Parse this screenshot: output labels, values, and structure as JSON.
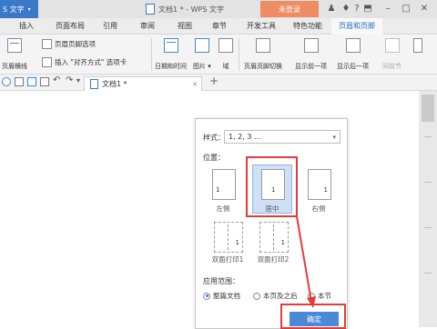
{
  "window": {
    "app_menu": "S 文字",
    "title": "文档1 * - WPS 文字",
    "login_button": "未登录"
  },
  "menu_tabs": [
    {
      "label": "插入"
    },
    {
      "label": "页面布局"
    },
    {
      "label": "引用"
    },
    {
      "label": "审阅"
    },
    {
      "label": "视图"
    },
    {
      "label": "章节"
    },
    {
      "label": "开发工具"
    },
    {
      "label": "特色功能"
    },
    {
      "label": "页眉和页脚",
      "active": true
    }
  ],
  "ribbon": {
    "header_line": "页眉横线",
    "header_footer_options": "页眉页脚选项",
    "insert_align_tab": "插入 \"对齐方式\" 选项卡",
    "date_time": "日期和时间",
    "picture": "图片",
    "field": "域",
    "hf_switch": "页眉页脚切换",
    "show_prev": "显示前一项",
    "show_next": "显示后一项",
    "same_as_prev": "同前节"
  },
  "doc_tab": {
    "label": "文档1 *"
  },
  "dialog": {
    "style_label": "样式：",
    "style_value": "1, 2, 3 ...",
    "position_label": "位置：",
    "positions": [
      {
        "label": "左侧",
        "number": "1"
      },
      {
        "label": "居中",
        "number": "1",
        "selected": true
      },
      {
        "label": "右侧",
        "number": "1"
      },
      {
        "label": "双面打印1",
        "number": "1"
      },
      {
        "label": "双面打印2",
        "number": "1"
      }
    ],
    "scope_label": "应用范围：",
    "scopes": [
      {
        "label": "整篇文档",
        "selected": true
      },
      {
        "label": "本页及之后",
        "selected": false
      },
      {
        "label": "本节",
        "selected": false
      }
    ],
    "ok_button": "确定"
  },
  "colors": {
    "accent_blue": "#2e73c4",
    "login_orange": "#f08c64",
    "highlight_red": "#e53a3a",
    "ok_blue": "#4a88d8"
  }
}
